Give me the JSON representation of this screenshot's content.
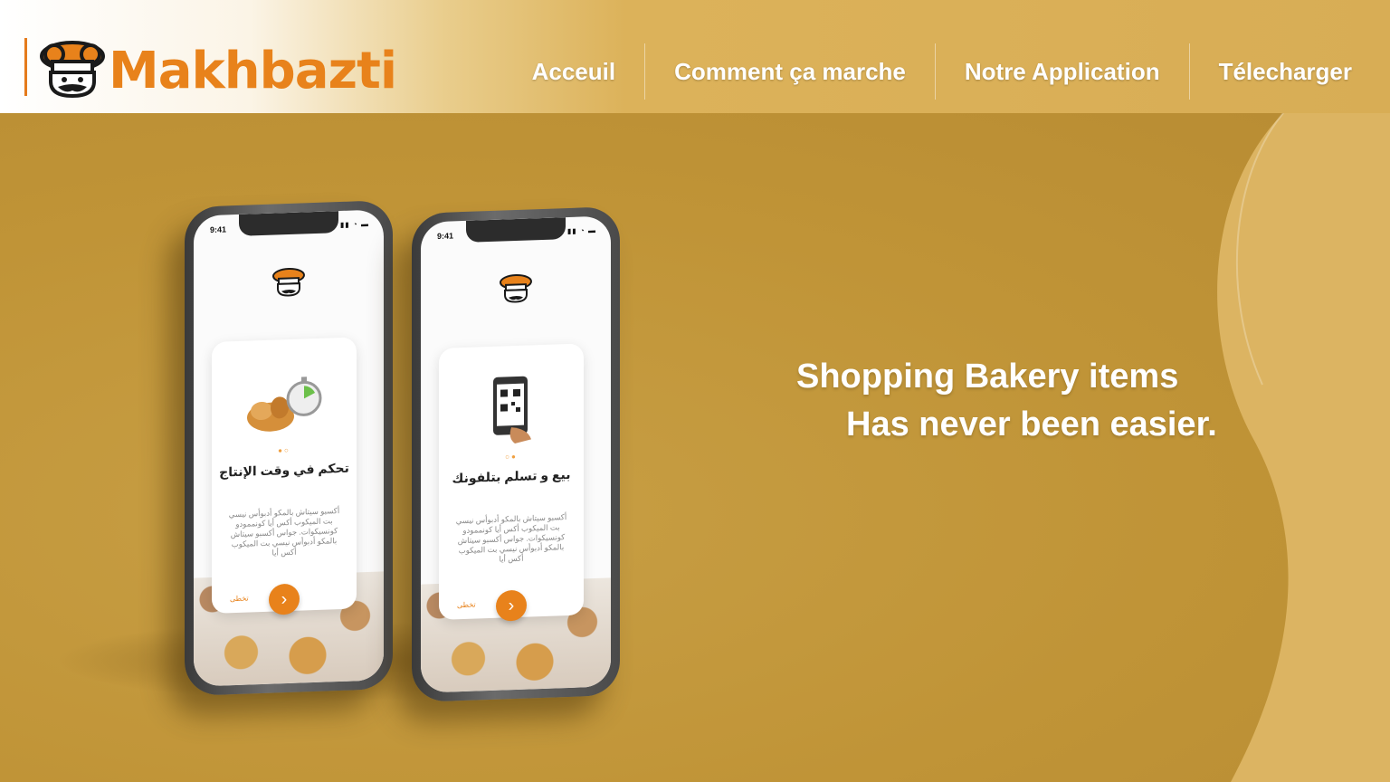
{
  "header": {
    "brand": "Makhbazti",
    "logo_icon": "chef-mascot-icon",
    "nav": [
      {
        "label": "Acceuil"
      },
      {
        "label": "Comment ça marche"
      },
      {
        "label": "Notre Application"
      },
      {
        "label": "Télecharger"
      }
    ]
  },
  "hero": {
    "tagline_line1": "Shopping Bakery items",
    "tagline_line2": "Has never been easier.",
    "phones": [
      {
        "time": "9:41",
        "title": "تحكم في وقت الإنتاج",
        "body": "أكسبو سيتاش بالمكو أدبوأس نيسي بت الميكوب أكس أيا كونممودو كونسيكوات. جواس أكسبو سيتاش بالمكو أدبوأس نيسي بت الميكوب أكس أيا",
        "skip": "تخطى",
        "illustration": "bread-and-stopwatch-illustration"
      },
      {
        "time": "9:41",
        "title": "بيع و تسلم بتلفونك",
        "body": "أكسبو سيتاش بالمكو أدبوأس نيسي بت الميكوب أكس أيا كونممودو كونسيكوات. جواس أكسبو سيتاش بالمكو أدبوأس نيسي بت الميكوب أكس أيا",
        "skip": "تخطى",
        "illustration": "phone-qr-code-illustration"
      }
    ]
  },
  "colors": {
    "brand_orange": "#e8821b",
    "hero_gold": "#c39a3e",
    "nav_text": "#ffffff"
  }
}
